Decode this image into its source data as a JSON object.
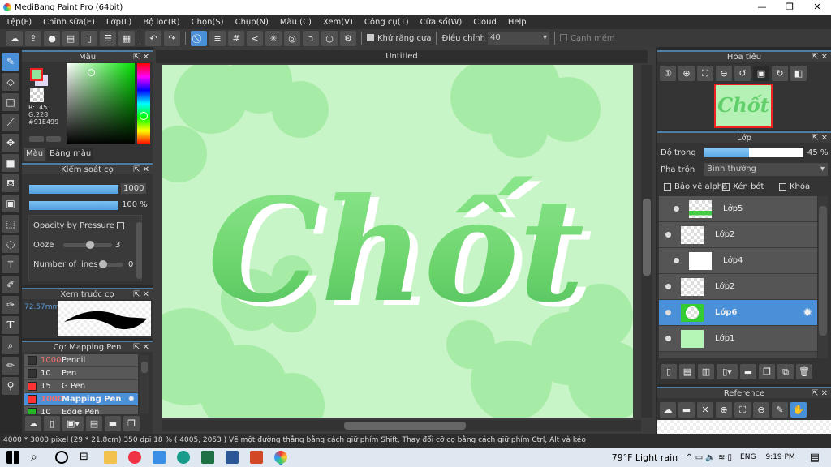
{
  "app": {
    "title": "MediBang Paint Pro (64bit)"
  },
  "menu": [
    "Tệp(F)",
    "Chỉnh sửa(E)",
    "Lớp(L)",
    "Bộ lọc(R)",
    "Chọn(S)",
    "Chụp(N)",
    "Màu (C)",
    "Xem(V)",
    "Công cụ(T)",
    "Cửa sổ(W)",
    "Cloud",
    "Help"
  ],
  "toolbar": {
    "antialias_label": "Khử răng cưa",
    "adjust_label": "Điều chỉnh",
    "adjust_value": "40",
    "soft_edge_label": "Cạnh mềm"
  },
  "color_panel": {
    "title": "Màu",
    "r": "R:145",
    "g": "G:228",
    "b": "B:153",
    "hex": "#91E499",
    "tabs": [
      "Màu",
      "Bảng màu"
    ],
    "fg": "#91E499"
  },
  "brush_control": {
    "title": "Kiểm soát cọ",
    "size": "1000",
    "opacity": "100 %",
    "opacity_by_pressure": "Opacity by Pressure",
    "ooze_label": "Ooze",
    "ooze_value": "3",
    "lines_label": "Number of lines",
    "lines_value": "0"
  },
  "brush_preview": {
    "title": "Xem trước cọ",
    "size": "72.57mm"
  },
  "brush_list": {
    "title": "Cọ: Mapping Pen",
    "items": [
      {
        "size": "1000",
        "name": "Pencil",
        "color": "#333333"
      },
      {
        "size": "10",
        "name": "Pen",
        "color": "#333333"
      },
      {
        "size": "15",
        "name": "G Pen",
        "color": "#ff3333"
      },
      {
        "size": "1000",
        "name": "Mapping Pen",
        "color": "#ff3333",
        "selected": true
      },
      {
        "size": "10",
        "name": "Edge Pen",
        "color": "#22bb22"
      }
    ]
  },
  "canvas": {
    "tab": "Untitled",
    "text": "Chốt"
  },
  "navigator": {
    "title": "Hoa tiêu"
  },
  "layers": {
    "title": "Lớp",
    "opacity_label": "Độ trong",
    "opacity_value": "45 %",
    "opacity": 45,
    "blend_label": "Pha trộn",
    "blend_value": "Bình thường",
    "protect_alpha": "Bảo vệ alpha",
    "clipping": "Xén bớt",
    "lock": "Khóa",
    "items": [
      {
        "name": "Lớp5"
      },
      {
        "name": "Lớp2"
      },
      {
        "name": "Lớp4"
      },
      {
        "name": "Lớp2"
      },
      {
        "name": "Lớp6",
        "selected": true
      },
      {
        "name": "Lớp1"
      }
    ]
  },
  "reference": {
    "title": "Reference"
  },
  "status": {
    "text": "4000 * 3000 pixel   (29 * 21.8cm)   350 dpi   18 %   ( 4005, 2053 )   Vẽ một đường thẳng bằng cách giữ phím Shift, Thay đổi cỡ cọ bằng cách giữ phím Ctrl, Alt và kéo"
  },
  "taskbar": {
    "weather": "79°F  Light rain",
    "lang": "ENG",
    "time": "9:19 PM"
  }
}
